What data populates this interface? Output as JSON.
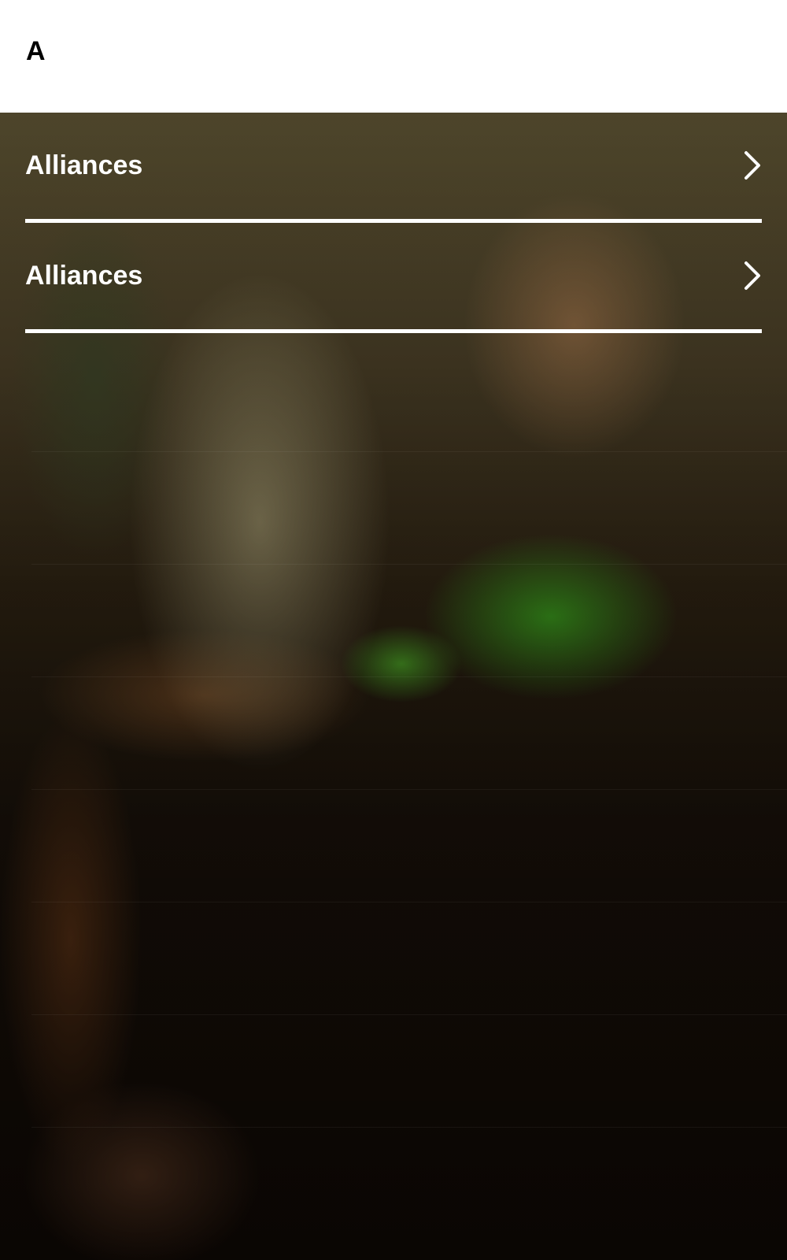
{
  "header": {
    "title": "A"
  },
  "menu": {
    "items": [
      {
        "label": "Alliances",
        "icon": "chevron-right-icon"
      },
      {
        "label": "Alliances",
        "icon": "chevron-right-icon"
      }
    ]
  },
  "colors": {
    "header_background": "#ffffff",
    "menu_text": "#ffffff",
    "divider": "#ffffff"
  }
}
